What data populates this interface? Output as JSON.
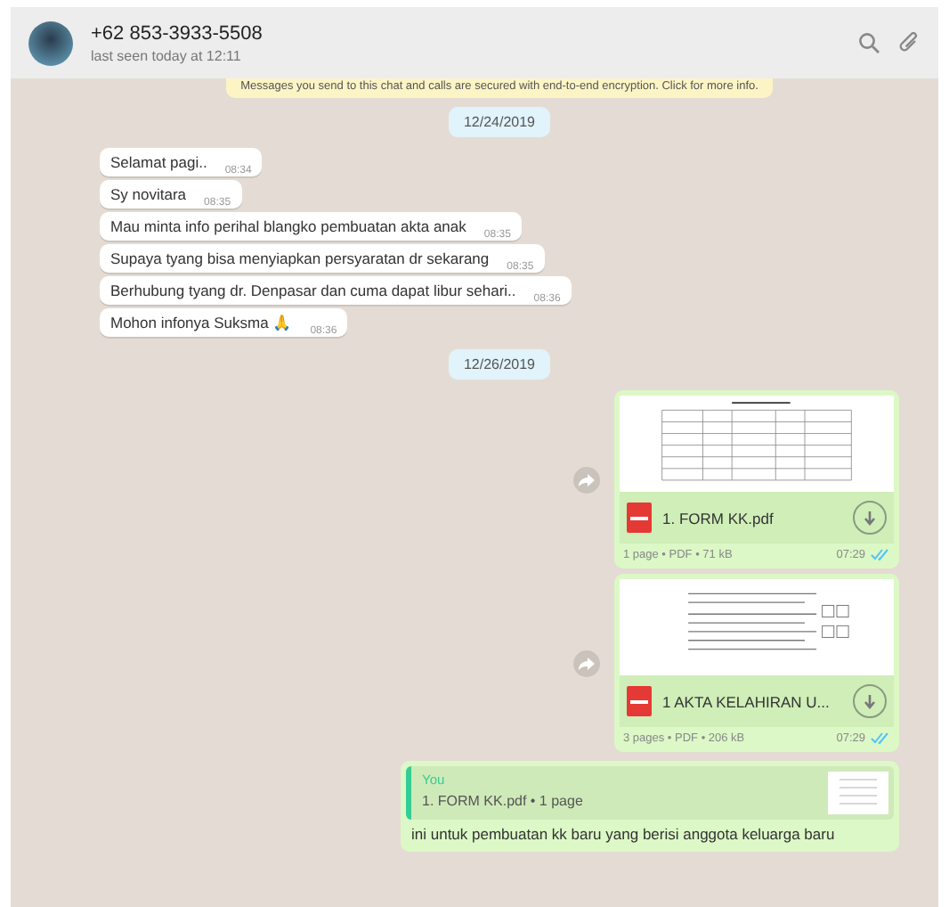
{
  "header": {
    "name": "+62 853-3933-5508",
    "status": "last seen today at 12:11"
  },
  "encryption_notice": "Messages you send to this chat and calls are secured with end-to-end encryption. Click for more info.",
  "messages": [
    {
      "kind": "date",
      "text": "12/24/2019"
    },
    {
      "kind": "text",
      "text": "Selamat pagi..",
      "time": "08:34"
    },
    {
      "kind": "text",
      "text": "Sy novitara",
      "time": "08:35"
    },
    {
      "kind": "text",
      "text": "Mau minta info perihal blangko pembuatan akta anak",
      "time": "08:35"
    },
    {
      "kind": "text",
      "text": "Supaya tyang bisa menyiapkan persyaratan dr sekarang",
      "time": "08:35"
    },
    {
      "kind": "text",
      "text": "Berhubung tyang dr. Denpasar dan cuma dapat libur sehari..",
      "time": "08:36"
    },
    {
      "kind": "text",
      "text": "Mohon infonya Suksma 🙏",
      "time": "08:36"
    },
    {
      "kind": "date",
      "text": "12/26/2019"
    },
    {
      "kind": "document",
      "file_name": "1. FORM KK.pdf",
      "meta": "1 page • PDF • 71 kB",
      "time": "07:29",
      "read": true
    },
    {
      "kind": "document",
      "file_name": "1 AKTA KELAHIRAN U...",
      "meta": "3 pages • PDF • 206 kB",
      "time": "07:29",
      "read": true
    },
    {
      "kind": "reply",
      "quote_author": "You",
      "quote_text": "1. FORM KK.pdf • 1 page",
      "text": "ini untuk pembuatan kk baru yang berisi anggota keluarga baru"
    }
  ]
}
